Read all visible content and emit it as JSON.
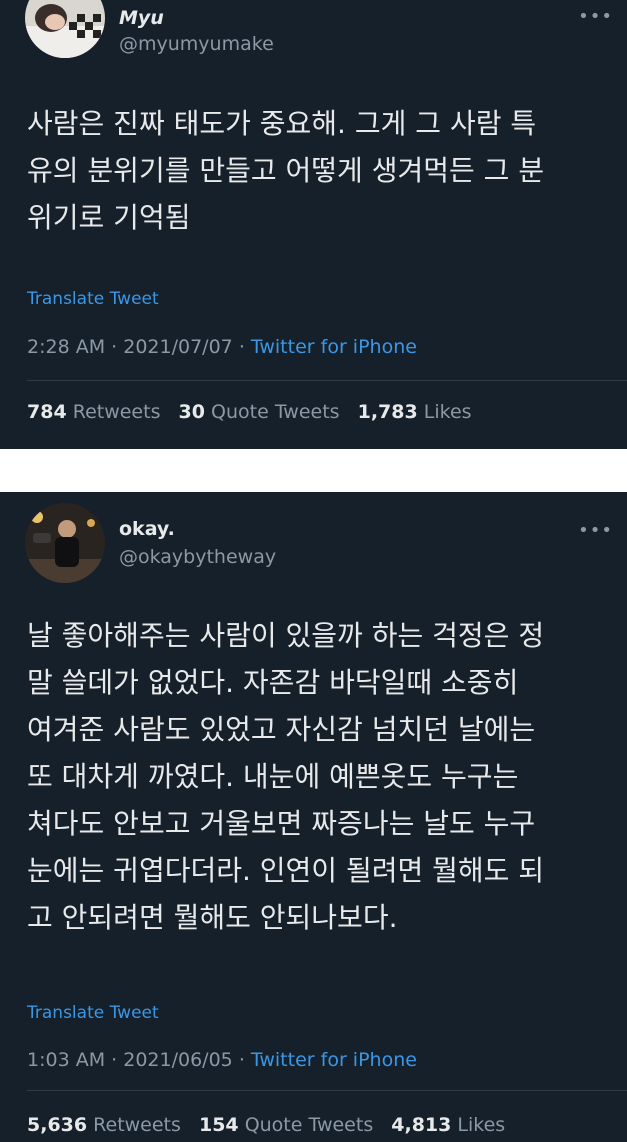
{
  "tweets": [
    {
      "name": "Myu",
      "handle": "@myumyumake",
      "more_icon": "more-horizontal-icon",
      "text": "사람은 진짜 태도가 중요해. 그게 그 사람 특\n유의 분위기를 만들고 어떻게 생겨먹든 그 분\n위기로 기억됨",
      "translate_label": "Translate Tweet",
      "time": "2:28 AM",
      "date": "2021/07/07",
      "source": "Twitter for iPhone",
      "retweets_count": "784",
      "retweets_label": "Retweets",
      "quotes_count": "30",
      "quotes_label": "Quote Tweets",
      "likes_count": "1,783",
      "likes_label": "Likes"
    },
    {
      "name": "okay.",
      "handle": "@okaybytheway",
      "more_icon": "more-horizontal-icon",
      "text": "날 좋아해주는 사람이 있을까 하는 걱정은 정\n말 쓸데가 없었다. 자존감 바닥일때 소중히\n여겨준 사람도 있었고 자신감 넘치던 날에는\n또 대차게 까였다. 내눈에 예쁜옷도 누구는\n쳐다도 안보고 거울보면 짜증나는 날도 누구\n눈에는 귀엽다더라. 인연이 될려면 뭘해도 되\n고 안되려면 뭘해도 안되나보다.",
      "translate_label": "Translate Tweet",
      "time": "1:03 AM",
      "date": "2021/06/05",
      "source": "Twitter for iPhone",
      "retweets_count": "5,636",
      "retweets_label": "Retweets",
      "quotes_count": "154",
      "quotes_label": "Quote Tweets",
      "likes_count": "4,813",
      "likes_label": "Likes"
    }
  ],
  "colors": {
    "background": "#15202b",
    "text": "#e7e9ea",
    "secondary": "#8b98a5",
    "link": "#3b97e6"
  }
}
